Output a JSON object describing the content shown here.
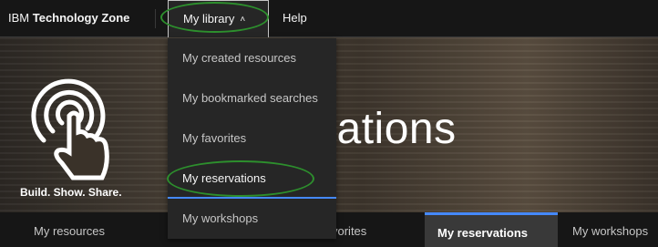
{
  "header": {
    "brand_prefix": "IBM ",
    "brand_name": "Technology Zone",
    "nav_library": "My library",
    "nav_help": "Help"
  },
  "hero": {
    "tagline": "Build. Show. Share.",
    "title_visible": "vations"
  },
  "dropdown": {
    "items": [
      {
        "label": "My created resources"
      },
      {
        "label": "My bookmarked searches"
      },
      {
        "label": "My favorites"
      },
      {
        "label": "My reservations"
      },
      {
        "label": "My workshops"
      }
    ]
  },
  "tabs": {
    "resources": "My resources",
    "favorites_visible": "vorites",
    "reservations": "My reservations",
    "workshops": "My workshops"
  },
  "colors": {
    "accent": "#4589ff",
    "annotation": "#2d8f2d"
  },
  "icons": {
    "logo": "touch-target-icon",
    "chevron": "chevron-up-icon"
  }
}
